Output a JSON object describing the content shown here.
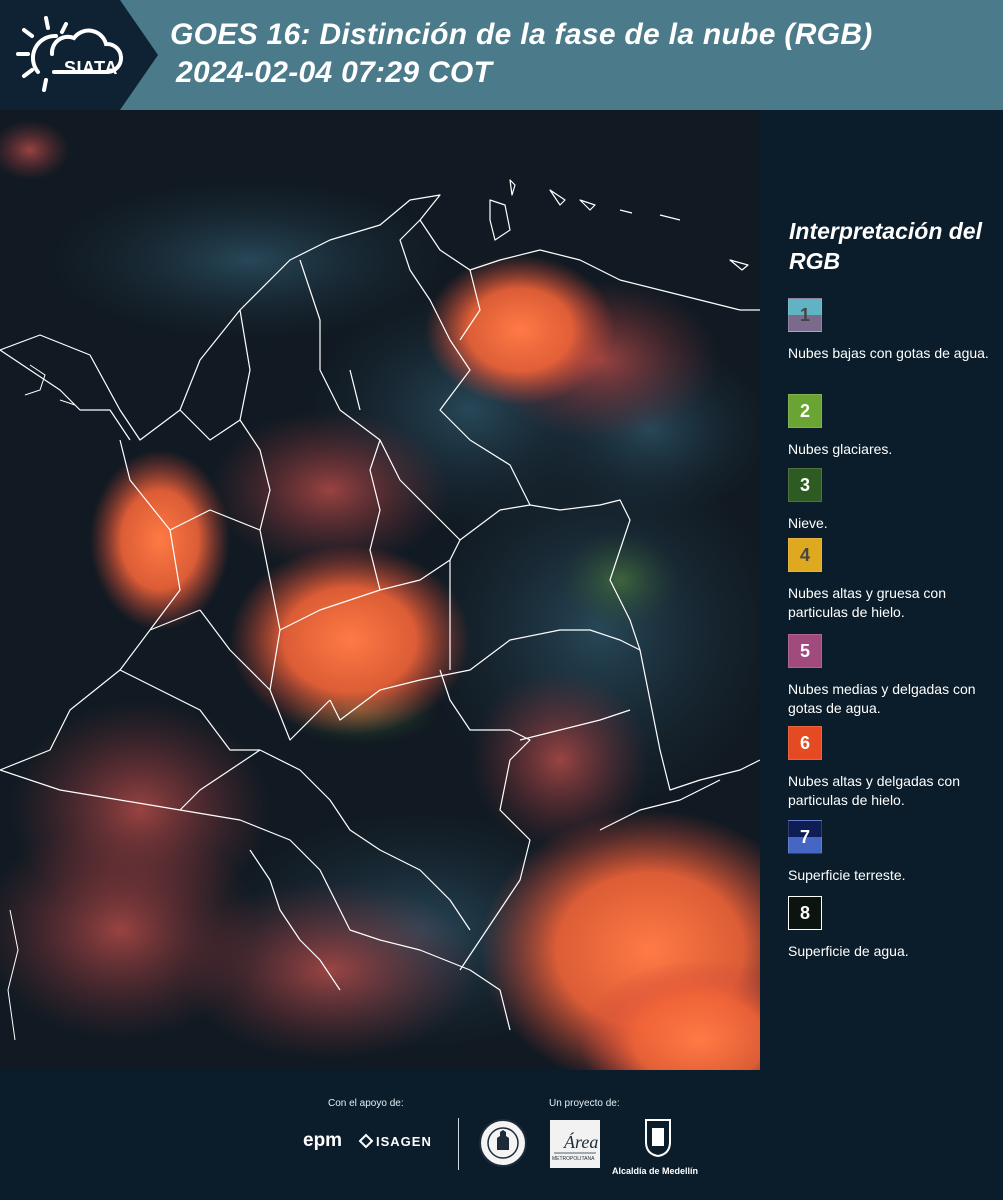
{
  "header": {
    "logo_text": "SIATA",
    "title_line1": "GOES 16: Distinción de la fase de la nube (RGB)",
    "title_line2": "2024-02-04 07:29 COT"
  },
  "map": {
    "background_color": "#101820",
    "dominant_colors": [
      "#ff6a3c",
      "#c8443a",
      "#2a4a5c",
      "#3b6c3a"
    ]
  },
  "legend": {
    "title": "Interpretación del RGB",
    "items": [
      {
        "number": "1",
        "label": "Nubes bajas con gotas de agua.",
        "color_top": "#5fb3c3",
        "color_bottom": "#7c6a8e",
        "num_color": "#444"
      },
      {
        "number": "2",
        "label": "Nubes glaciares.",
        "color_top": "#6aa533",
        "color_bottom": "#6aa533",
        "num_color": "#fff"
      },
      {
        "number": "3",
        "label": "Nieve.",
        "color_top": "#2e5b22",
        "color_bottom": "#2e5b22",
        "num_color": "#fff"
      },
      {
        "number": "4",
        "label": "Nubes altas y gruesa con particulas de hielo.",
        "color_top": "#dfa91f",
        "color_bottom": "#dfa91f",
        "num_color": "#444"
      },
      {
        "number": "5",
        "label": "Nubes medias y delgadas con gotas de agua.",
        "color_top": "#a14a7e",
        "color_bottom": "#a14a7e",
        "num_color": "#fff"
      },
      {
        "number": "6",
        "label": "Nubes altas y delgadas con particulas de hielo.",
        "color_top": "#e64a22",
        "color_bottom": "#e64a22",
        "num_color": "#fff"
      },
      {
        "number": "7",
        "label": "Superficie terreste.",
        "color_top": "#0e1e55",
        "color_bottom": "#4566c2",
        "num_color": "#fff"
      },
      {
        "number": "8",
        "label": "Superficie de agua.",
        "color_top": "#0c1410",
        "color_bottom": "#0c1410",
        "num_color": "#fff"
      }
    ]
  },
  "footer": {
    "support_label": "Con el apoyo de:",
    "project_label": "Un proyecto de:",
    "epm": "epm",
    "isagen": "ISAGEN",
    "area_text": "Área",
    "area_sub": "METROPOLITANA",
    "alcaldia": "Alcaldía de Medellín"
  }
}
